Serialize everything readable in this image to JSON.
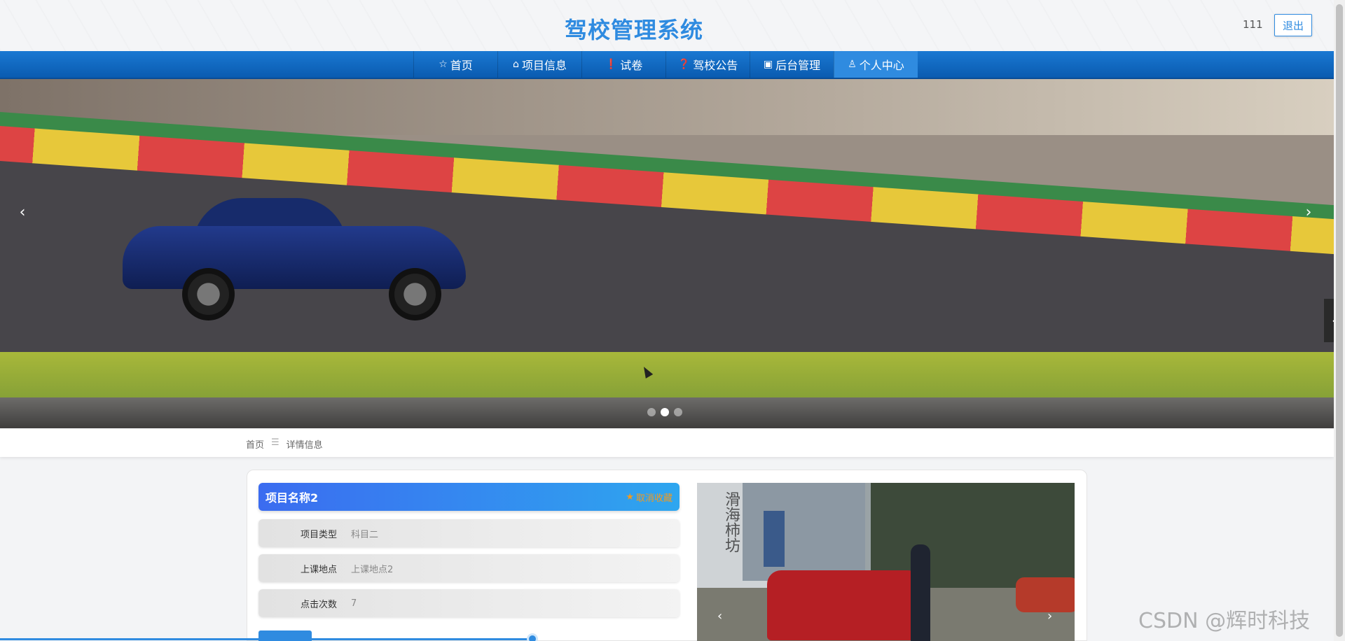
{
  "header": {
    "site_title": "驾校管理系统",
    "username": "111",
    "logout_label": "退出"
  },
  "nav": {
    "items": [
      {
        "label": "首页",
        "icon": "star-icon"
      },
      {
        "label": "项目信息",
        "icon": "bag-icon"
      },
      {
        "label": "试卷",
        "icon": "info-icon"
      },
      {
        "label": "驾校公告",
        "icon": "question-icon"
      },
      {
        "label": "后台管理",
        "icon": "briefcase-icon"
      },
      {
        "label": "个人中心",
        "icon": "user-icon"
      }
    ],
    "active_index": 5
  },
  "carousel": {
    "slide_count": 3,
    "active_slide": 1
  },
  "breadcrumb": {
    "home": "首页",
    "current": "详情信息"
  },
  "detail": {
    "name": "项目名称2",
    "favorite_label": "取消收藏",
    "fields": [
      {
        "label": "项目类型",
        "value": "科目二"
      },
      {
        "label": "上课地点",
        "value": "上课地点2"
      },
      {
        "label": "点击次数",
        "value": "7"
      }
    ]
  },
  "photo": {
    "calligraphy": "滑海柿坊"
  },
  "watermark": "CSDN @辉时科技",
  "colors": {
    "brand": "#2f8be0",
    "nav_bg": "#0a5bb0",
    "favorite": "#f39a1e"
  }
}
